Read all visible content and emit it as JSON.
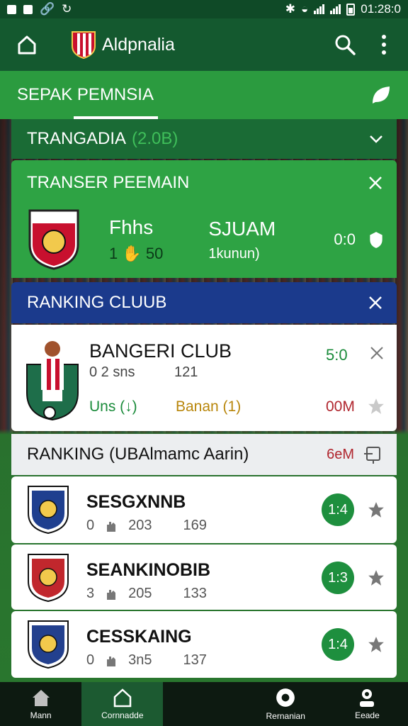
{
  "status": {
    "time": "01:28:0"
  },
  "appbar": {
    "title": "Aldpnalia"
  },
  "tabstrip": {
    "tab_label": "SEPAK PEMNSIA"
  },
  "section_collapsed": {
    "title": "TRANGADIA",
    "tag": "(2.0B)"
  },
  "transfer": {
    "title": "TRANSER PEEMAIN",
    "team_name": "Fhhs",
    "team_stats": "1 ✋ 50",
    "player_name": "SJUAM",
    "player_sub": "1kunun)",
    "score": "0:0"
  },
  "ranking_header": {
    "title": "RANKING CLUUB"
  },
  "featured": {
    "club_name": "BANGERI CLUB",
    "stats": "0  2 sns",
    "stat_value": "121",
    "score": "5:0",
    "label_left": "Uns (↓)",
    "label_mid": "Banan (1)",
    "label_right": "00M"
  },
  "ranking_sub": {
    "title": "RANKING (UBAlmamc Aarin)",
    "tag": "6eM"
  },
  "rankings": [
    {
      "name": "SESGXNNB",
      "stats_a": "0",
      "stats_b": "203",
      "stats_c": "169",
      "badge": "1:4",
      "crest_color": "#1f3f8f"
    },
    {
      "name": "SEANKINOBIB",
      "stats_a": "3",
      "stats_b": "205",
      "stats_c": "133",
      "badge": "1:3",
      "crest_color": "#c1272d"
    },
    {
      "name": "CESSKAING",
      "stats_a": "0",
      "stats_b": "3n5",
      "stats_c": "137",
      "badge": "1:4",
      "crest_color": "#23408e"
    }
  ],
  "nav": [
    {
      "label": "Mann",
      "icon": "home-icon"
    },
    {
      "label": "Cornnadde",
      "icon": "home-outline-icon"
    },
    {
      "label": "",
      "icon": ""
    },
    {
      "label": "Rernanian",
      "icon": "ball-icon"
    },
    {
      "label": "Eeade",
      "icon": "profile-icon"
    }
  ],
  "colors": {
    "primary": "#14592f",
    "accent": "#2ea344",
    "ranking_blue": "#1b3a8c"
  }
}
